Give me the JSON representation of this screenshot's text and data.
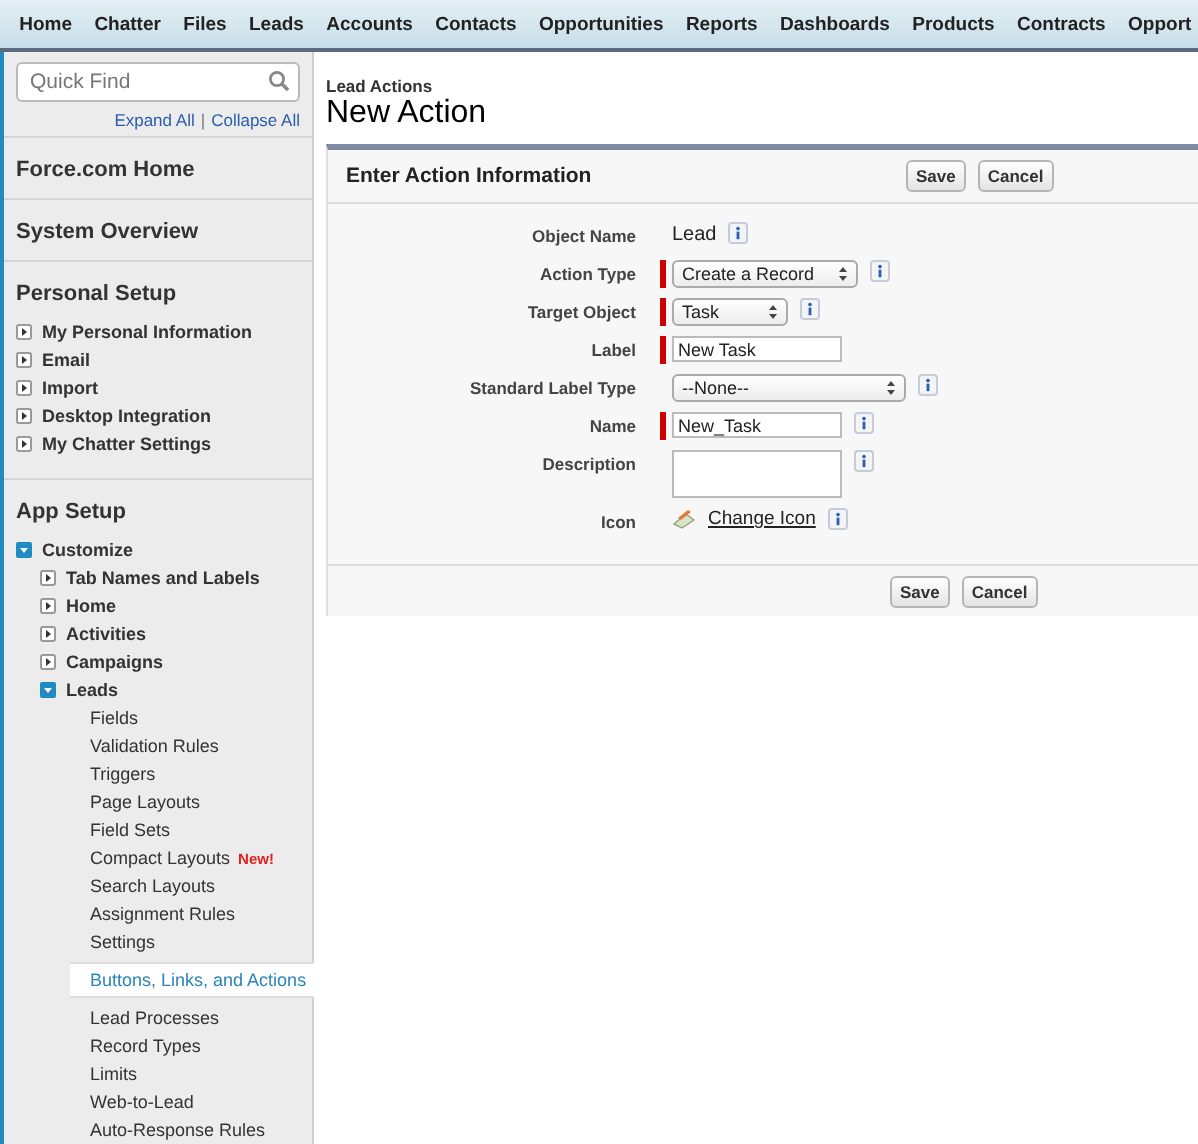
{
  "tabs": [
    {
      "label": "Home"
    },
    {
      "label": "Chatter"
    },
    {
      "label": "Files"
    },
    {
      "label": "Leads"
    },
    {
      "label": "Accounts"
    },
    {
      "label": "Contacts"
    },
    {
      "label": "Opportunities"
    },
    {
      "label": "Reports"
    },
    {
      "label": "Dashboards"
    },
    {
      "label": "Products"
    },
    {
      "label": "Contracts"
    },
    {
      "label": "Opport"
    }
  ],
  "sidebar": {
    "quick_find": {
      "placeholder": "Quick Find"
    },
    "expand_all": "Expand All",
    "separator": "|",
    "collapse_all": "Collapse All",
    "sections": [
      {
        "title": "Force.com Home"
      },
      {
        "title": "System Overview"
      },
      {
        "title": "Personal Setup",
        "items": [
          {
            "label": "My Personal Information",
            "expanded": false
          },
          {
            "label": "Email",
            "expanded": false
          },
          {
            "label": "Import",
            "expanded": false
          },
          {
            "label": "Desktop Integration",
            "expanded": false
          },
          {
            "label": "My Chatter Settings",
            "expanded": false
          }
        ]
      },
      {
        "title": "App Setup",
        "items": [
          {
            "label": "Customize",
            "expanded": true,
            "children": [
              {
                "label": "Tab Names and Labels",
                "expanded": false
              },
              {
                "label": "Home",
                "expanded": false
              },
              {
                "label": "Activities",
                "expanded": false
              },
              {
                "label": "Campaigns",
                "expanded": false
              },
              {
                "label": "Leads",
                "expanded": true,
                "children": [
                  {
                    "label": "Fields",
                    "selected": false
                  },
                  {
                    "label": "Validation Rules",
                    "selected": false
                  },
                  {
                    "label": "Triggers",
                    "selected": false
                  },
                  {
                    "label": "Page Layouts",
                    "selected": false
                  },
                  {
                    "label": "Field Sets",
                    "selected": false
                  },
                  {
                    "label": "Compact Layouts",
                    "badge": "New!",
                    "selected": false
                  },
                  {
                    "label": "Search Layouts",
                    "selected": false
                  },
                  {
                    "label": "Assignment Rules",
                    "selected": false
                  },
                  {
                    "label": "Settings",
                    "selected": false
                  },
                  {
                    "label": "Buttons, Links, and Actions",
                    "selected": true
                  },
                  {
                    "label": "Lead Processes",
                    "selected": false
                  },
                  {
                    "label": "Record Types",
                    "selected": false
                  },
                  {
                    "label": "Limits",
                    "selected": false
                  },
                  {
                    "label": "Web-to-Lead",
                    "selected": false
                  },
                  {
                    "label": "Auto-Response Rules",
                    "selected": false
                  }
                ]
              }
            ]
          }
        ]
      }
    ]
  },
  "page": {
    "breadcrumb": "Lead Actions",
    "title": "New Action"
  },
  "panel": {
    "title": "Enter Action Information",
    "buttons": [
      "Save",
      "Cancel"
    ],
    "footer_buttons": [
      "Save",
      "Cancel"
    ],
    "fields": [
      {
        "label": "Object Name",
        "kind": "text",
        "value": "Lead",
        "required": false,
        "info": true
      },
      {
        "label": "Action Type",
        "kind": "select",
        "value": "Create a Record",
        "required": true,
        "info": true
      },
      {
        "label": "Target Object",
        "kind": "select",
        "value": "Task",
        "required": true,
        "info": true
      },
      {
        "label": "Label",
        "kind": "input",
        "value": "New Task",
        "required": true,
        "info": false
      },
      {
        "label": "Standard Label Type",
        "kind": "select",
        "value": "--None--",
        "required": false,
        "info": true
      },
      {
        "label": "Name",
        "kind": "input",
        "value": "New_Task",
        "required": true,
        "info": true
      },
      {
        "label": "Description",
        "kind": "textarea",
        "required": false,
        "info": true
      },
      {
        "label": "Icon",
        "kind": "link",
        "value": "Change Icon",
        "required": false,
        "info": true
      }
    ]
  }
}
